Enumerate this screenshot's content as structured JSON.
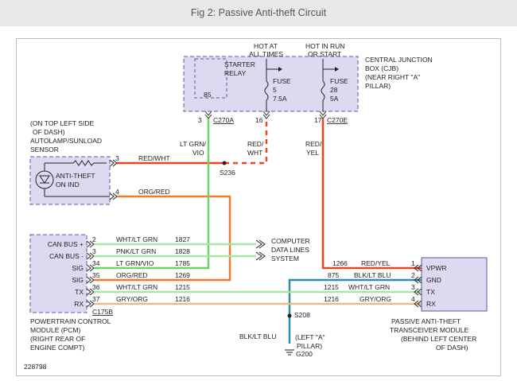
{
  "title": "Fig 2: Passive Anti-theft Circuit",
  "figure_number": "228798",
  "colors": {
    "header_bg": "#e8e8e8",
    "module_fill": "#dcd9f0",
    "module_border": "#5a5a99",
    "wire_red": "#e8461e",
    "wire_orange": "#f07b2a",
    "wire_green": "#6ad36a",
    "wire_light_green": "#a6e6a6",
    "wire_blue": "#2f8fa8",
    "wire_tan": "#e8b98a"
  },
  "cjb": {
    "hot_at_all_times": [
      "HOT AT",
      "ALL TIMES"
    ],
    "hot_in_run_or_start": [
      "HOT IN RUN",
      "OR START"
    ],
    "name": [
      "CENTRAL JUNCTION",
      "BOX (CJB)",
      "(NEAR RIGHT \"A\"",
      "PILLAR)"
    ],
    "starter_relay": [
      "STARTER",
      "RELAY"
    ],
    "relay_pin": "85",
    "fuse5": [
      "FUSE",
      "5",
      "7.5A"
    ],
    "fuse28": [
      "FUSE",
      "28",
      "5A"
    ],
    "pin3": "3",
    "conn_a": "C270A",
    "pin16": "16",
    "pin17": "17",
    "conn_e": "C270E"
  },
  "wire_colors": {
    "lt_grn_vio": [
      "LT GRN/",
      "VIO"
    ],
    "red_wht": [
      "RED/",
      "WHT"
    ],
    "red_yel": [
      "RED/",
      "YEL"
    ]
  },
  "sensor": {
    "location": [
      "(ON TOP LEFT SIDE",
      "OF DASH)"
    ],
    "name": [
      "AUTOLAMP/SUNLOAD",
      "SENSOR"
    ],
    "indicator": [
      "ANTI-THEFT",
      "ON IND"
    ],
    "pin3": "3",
    "pin4": "4",
    "wire3": "RED/WHT",
    "wire4": "ORG/RED"
  },
  "splices": {
    "s236": "S236",
    "s208": "S208",
    "ground": "G200",
    "ground_wire": "BLK/LT BLU",
    "ground_loc": [
      "(LEFT \"A\"",
      "PILLAR)"
    ]
  },
  "pcm": {
    "signals": [
      "CAN BUS +",
      "CAN BUS -",
      "SIG",
      "SIG",
      "TX",
      "RX"
    ],
    "connector": "C175B",
    "name": [
      "POWERTRAIN CONTROL",
      "MODULE (PCM)",
      "(RIGHT REAR OF",
      "ENGINE COMPT)"
    ],
    "rows": [
      {
        "pin": "2",
        "color": "WHT/LT GRN",
        "circuit": "1827"
      },
      {
        "pin": "3",
        "color": "PNK/LT GRN",
        "circuit": "1828"
      },
      {
        "pin": "34",
        "color": "LT GRN/VIO",
        "circuit": "1785"
      },
      {
        "pin": "35",
        "color": "ORG/RED",
        "circuit": "1269"
      },
      {
        "pin": "36",
        "color": "WHT/LT GRN",
        "circuit": "1215"
      },
      {
        "pin": "37",
        "color": "GRY/ORG",
        "circuit": "1216"
      }
    ]
  },
  "data_lines": [
    "COMPUTER",
    "DATA LINES",
    "SYSTEM"
  ],
  "pats": {
    "signals": [
      "VPWR",
      "GND",
      "TX",
      "RX"
    ],
    "name": [
      "PASSIVE ANTI-THEFT",
      "TRANSCEIVER MODULE",
      "(BEHIND LEFT CENTER",
      "OF DASH)"
    ],
    "rows": [
      {
        "pin": "1",
        "color": "RED/YEL",
        "circuit": "1266"
      },
      {
        "pin": "2",
        "color": "BLK/LT BLU",
        "circuit": "875"
      },
      {
        "pin": "3",
        "color": "WHT/LT GRN",
        "circuit": "1215"
      },
      {
        "pin": "4",
        "color": "GRY/ORG",
        "circuit": "1216"
      }
    ]
  }
}
